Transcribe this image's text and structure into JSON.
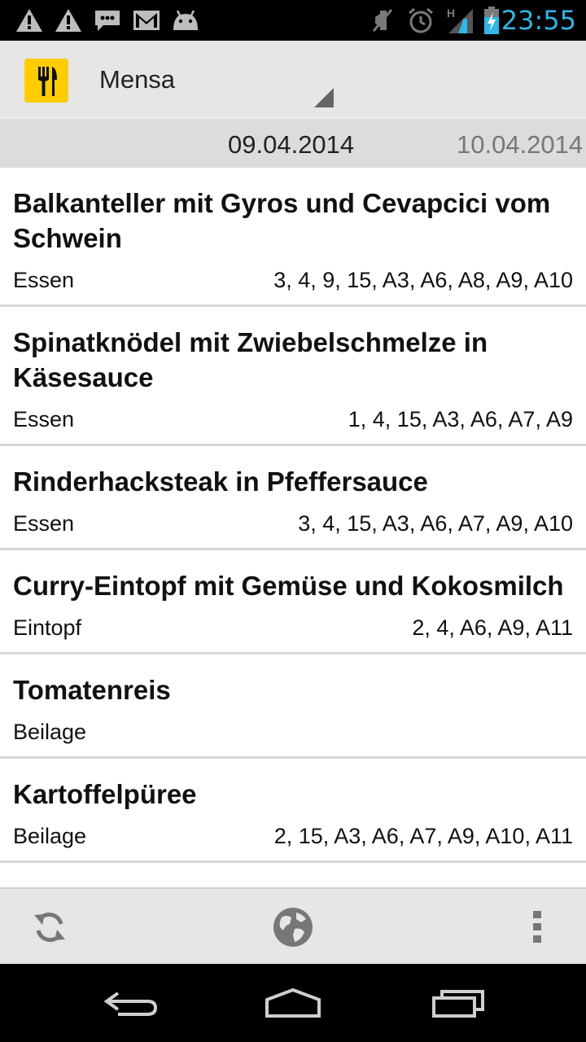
{
  "status_bar": {
    "time": "23:55",
    "network_label": "H",
    "icons": [
      "warning-icon",
      "warning-icon",
      "chat-icon",
      "gmail-icon",
      "android-icon",
      "mute-icon",
      "alarm-icon",
      "signal-icon",
      "battery-charging-icon"
    ],
    "accent_color": "#33b5e5"
  },
  "action_bar": {
    "title": "Mensa",
    "app_icon": "fork-knife-icon",
    "icon_color": "#ffcc00"
  },
  "date_bar": {
    "current": "09.04.2014",
    "next": "10.04.2014"
  },
  "meals": [
    {
      "name": "Balkanteller mit Gyros und Cevapcici vom Schwein",
      "category": "Essen",
      "additives": "3, 4, 9, 15, A3, A6, A8, A9, A10"
    },
    {
      "name": "Spinatknödel mit Zwiebelschmelze in Käsesauce",
      "category": "Essen",
      "additives": "1, 4, 15, A3, A6, A7, A9"
    },
    {
      "name": "Rinderhacksteak in Pfeffersauce",
      "category": "Essen",
      "additives": "3, 4, 15, A3, A6, A7, A9, A10"
    },
    {
      "name": "Curry-Eintopf mit Gemüse und Kokosmilch",
      "category": "Eintopf",
      "additives": "2, 4, A6, A9, A11"
    },
    {
      "name": "Tomatenreis",
      "category": "Beilage",
      "additives": ""
    },
    {
      "name": "Kartoffelpüree",
      "category": "Beilage",
      "additives": "2, 15, A3, A6, A7, A9, A10, A11"
    }
  ],
  "bottom_bar": {
    "icons": [
      "refresh-icon",
      "globe-icon",
      "overflow-menu-icon"
    ]
  },
  "nav_bar": {
    "icons": [
      "back-icon",
      "home-icon",
      "recent-apps-icon"
    ]
  }
}
